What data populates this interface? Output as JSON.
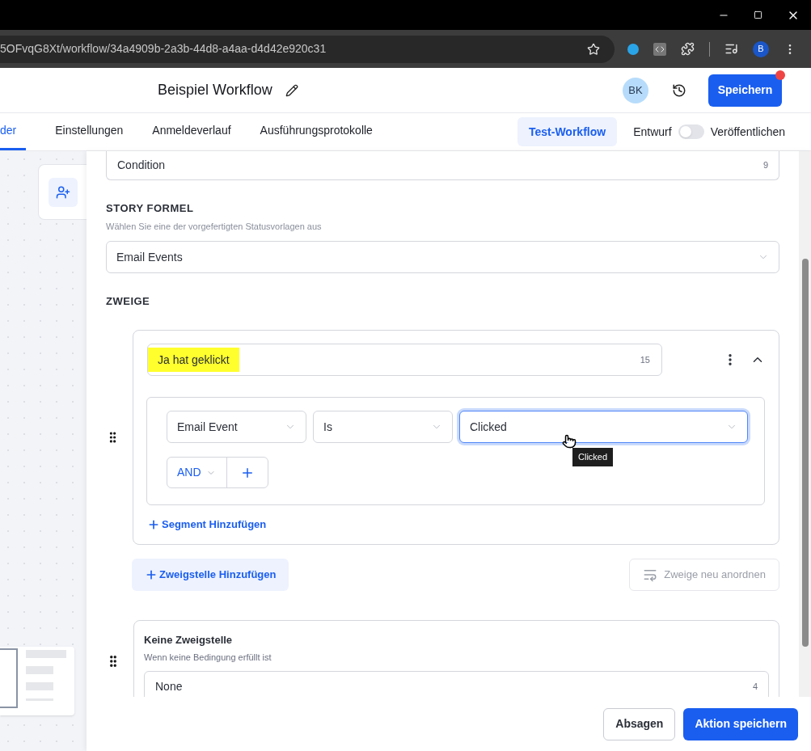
{
  "browser": {
    "url": "5OFvqG8Xt/workflow/34a4909b-2a3b-44d8-a4aa-d4d42e920c31",
    "profile": "B"
  },
  "header": {
    "title": "Beispiel Workflow",
    "avatar": "BK",
    "save_button": "Speichern",
    "unsaved": true
  },
  "tabs": [
    {
      "label": "der",
      "selected": true
    },
    {
      "label": "Einstellungen",
      "selected": false
    },
    {
      "label": "Anmeldeverlauf",
      "selected": false
    },
    {
      "label": "Ausführungsprotokolle",
      "selected": false
    }
  ],
  "test_button": "Test-Workflow",
  "publish": {
    "left_label": "Entwurf",
    "right_label": "Veröffentlichen",
    "on": false
  },
  "panel": {
    "condition_field": {
      "value": "Condition",
      "count": "9"
    },
    "story": {
      "heading": "STORY FORMEL",
      "hint": "Wählen Sie eine der vorgefertigten Statusvorlagen aus",
      "value": "Email Events"
    },
    "branches_heading": "ZWEIGE",
    "branches": [
      {
        "name": "Ja hat geklickt",
        "highlighted": true,
        "count": "15",
        "expanded": true,
        "rules": [
          {
            "field": "Email Event",
            "operator": "Is",
            "value": "Clicked",
            "focused": true,
            "tooltip": "Clicked"
          }
        ],
        "join": "AND",
        "add_segment": "Segment Hinzufügen"
      }
    ],
    "add_branch": "Zweigstelle Hinzufügen",
    "reorder": {
      "label": "Zweige neu anordnen",
      "disabled": true
    },
    "default_branch": {
      "title": "Keine Zweigstelle",
      "subtitle": "Wenn keine Bedingung erfüllt ist",
      "value": "None",
      "count": "4"
    }
  },
  "footer": {
    "cancel": "Absagen",
    "save": "Aktion speichern"
  }
}
